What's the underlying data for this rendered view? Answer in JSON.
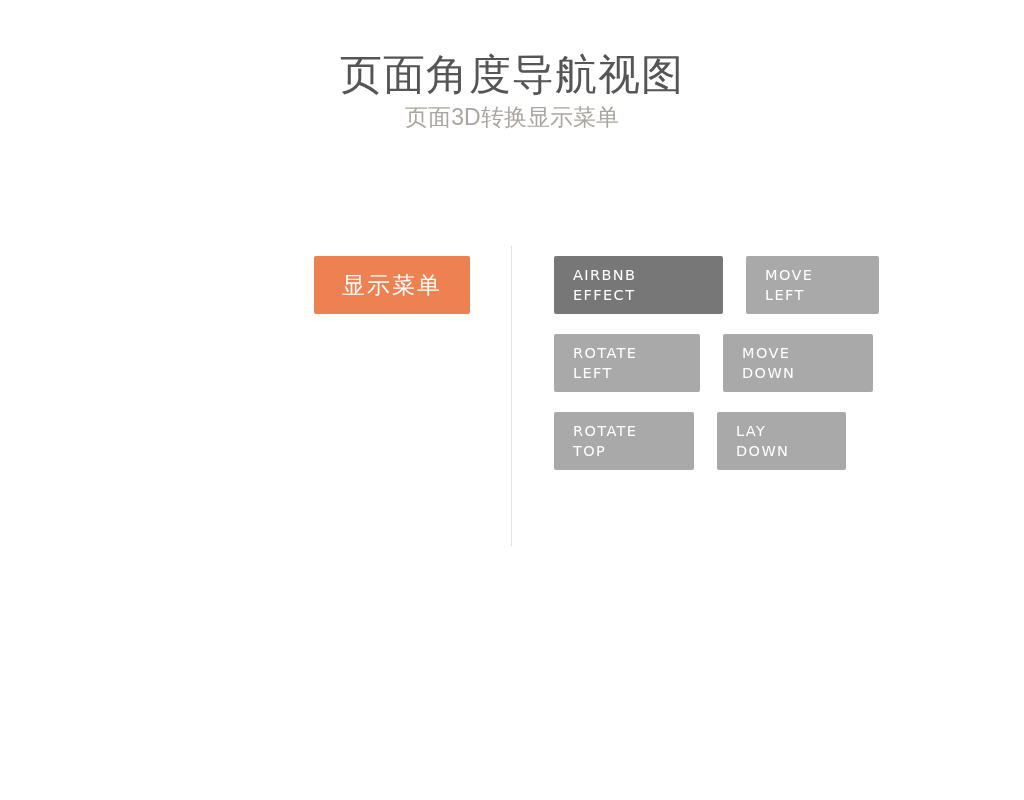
{
  "header": {
    "title": "页面角度导航视图",
    "subtitle": "页面3D转换显示菜单"
  },
  "show_menu_button": {
    "label": "显示菜单"
  },
  "effects": [
    {
      "label": "AIRBNB EFFECT",
      "selected": true
    },
    {
      "label": "MOVE LEFT",
      "selected": false
    },
    {
      "label": "ROTATE LEFT",
      "selected": false
    },
    {
      "label": "MOVE DOWN",
      "selected": false
    },
    {
      "label": "ROTATE TOP",
      "selected": false
    },
    {
      "label": "LAY DOWN",
      "selected": false
    }
  ]
}
